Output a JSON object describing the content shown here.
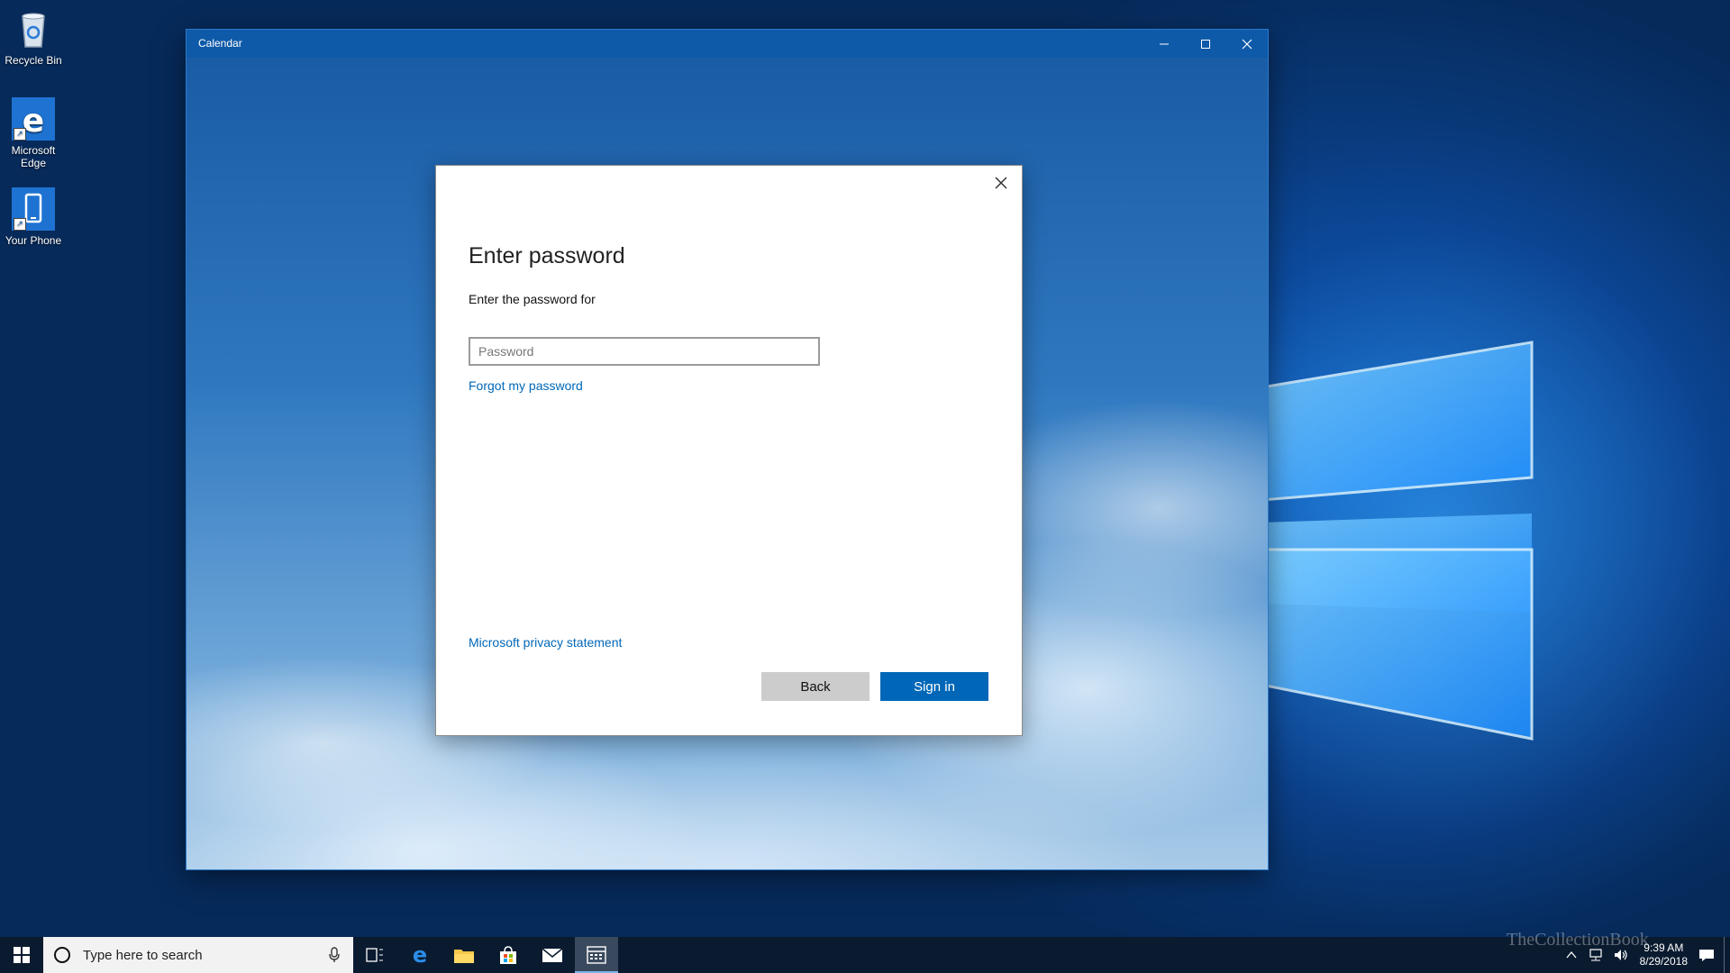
{
  "desktop": {
    "icons": [
      {
        "label": "Recycle Bin"
      },
      {
        "label": "Microsoft Edge"
      },
      {
        "label": "Your Phone"
      }
    ]
  },
  "window": {
    "title": "Calendar"
  },
  "dialog": {
    "title": "Enter password",
    "subtitle": "Enter the password for",
    "password_placeholder": "Password",
    "forgot_link": "Forgot my password",
    "privacy_link": "Microsoft privacy statement",
    "back_label": "Back",
    "signin_label": "Sign in"
  },
  "taskbar": {
    "search_placeholder": "Type here to search",
    "pinned": [
      "task-view-icon",
      "edge-icon",
      "file-explorer-icon",
      "store-icon",
      "mail-icon",
      "calendar-icon"
    ],
    "clock_time": "9:39 AM",
    "clock_date": "8/29/2018",
    "watermark": "TheCollectionBook"
  },
  "colors": {
    "accent": "#0067b8",
    "titlebar": "#0f5aa8",
    "taskbar": "#0a1b30"
  }
}
